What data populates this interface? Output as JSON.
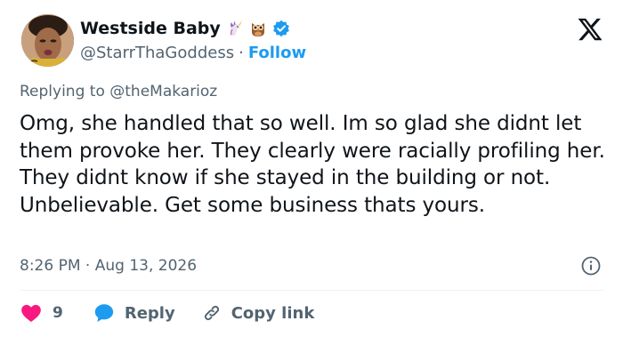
{
  "author": {
    "display_name": "Westside Baby",
    "name_emojis": [
      "unicorn-icon",
      "owl-icon"
    ],
    "verified": true,
    "handle": "@StarrThaGoddess",
    "separator": "·",
    "follow_label": "Follow"
  },
  "platform_logo": "x-logo-icon",
  "reply_context": {
    "prefix": "Replying to",
    "mention": "@theMakarioz"
  },
  "tweet": {
    "text": "Omg, she handled that so well. Im so glad she didnt let them provoke her. They clearly were racially profiling her. They didnt know if she stayed in the building or not. Unbelievable. Get some business thats yours."
  },
  "meta": {
    "time": "8:26 PM",
    "separator": "·",
    "date": "Aug 13, 2026"
  },
  "actions": {
    "like_count": "9",
    "reply_label": "Reply",
    "copy_link_label": "Copy link"
  },
  "colors": {
    "brand": "#1d9bf0",
    "heart": "#f91880",
    "text": "#0f1419",
    "muted": "#536471"
  }
}
